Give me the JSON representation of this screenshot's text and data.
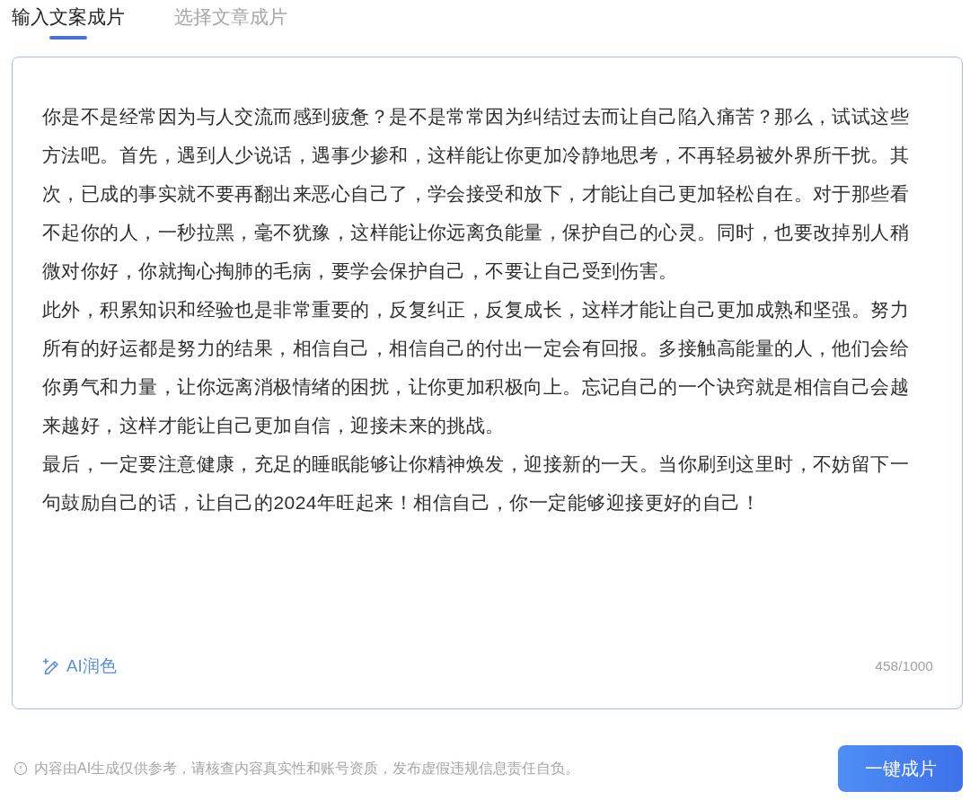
{
  "tabs": [
    {
      "label": "输入文案成片",
      "selected": true
    },
    {
      "label": "选择文章成片",
      "selected": false
    }
  ],
  "editor": {
    "paragraphs": [
      "你是不是经常因为与人交流而感到疲惫？是不是常常因为纠结过去而让自己陷入痛苦？那么，试试这些方法吧。首先，遇到人少说话，遇事少掺和，这样能让你更加冷静地思考，不再轻易被外界所干扰。其次，已成的事实就不要再翻出来恶心自己了，学会接受和放下，才能让自己更加轻松自在。对于那些看不起你的人，一秒拉黑，毫不犹豫，这样能让你远离负能量，保护自己的心灵。同时，也要改掉别人稍微对你好，你就掏心掏肺的毛病，要学会保护自己，不要让自己受到伤害。",
      "此外，积累知识和经验也是非常重要的，反复纠正，反复成长，这样才能让自己更加成熟和坚强。努力所有的好运都是努力的结果，相信自己，相信自己的付出一定会有回报。多接触高能量的人，他们会给你勇气和力量，让你远离消极情绪的困扰，让你更加积极向上。忘记自己的一个诀窍就是相信自己会越来越好，这样才能让自己更加自信，迎接未来的挑战。",
      "最后，一定要注意健康，充足的睡眠能够让你精神焕发，迎接新的一天。当你刷到这里时，不妨留下一句鼓励自己的话，让自己的2024年旺起来！相信自己，你一定能够迎接更好的自己！"
    ],
    "ai_button": {
      "label": "AI润色"
    },
    "counter": "458/1000"
  },
  "footer": {
    "notice": "内容由AI生成仅供参考，请核查内容真实性和账号资质，发布虚假违规信息责任自负。",
    "submit_button": {
      "label": "一键成片"
    }
  }
}
